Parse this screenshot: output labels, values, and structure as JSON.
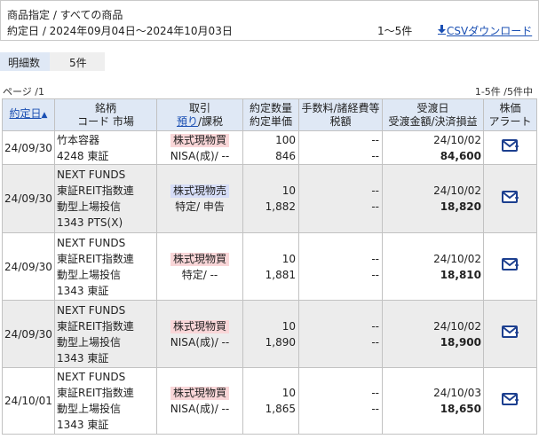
{
  "header": {
    "product_line": "商品指定 / すべての商品",
    "date_line": "約定日 / 2024年09月04日〜2024年10月03日",
    "count": "1〜5件",
    "csv_label": "CSVダウンロード"
  },
  "summary": {
    "label": "明細数",
    "value": "5件"
  },
  "pagination": {
    "page": "ページ /1",
    "range": "1-5件 /5件中"
  },
  "columns": {
    "date": "約定日",
    "name_1": "銘柄",
    "name_2": "コード 市場",
    "kind_1": "取引",
    "kind_2_a": "預り",
    "kind_2_b": "/課税",
    "qty_1": "約定数量",
    "qty_2": "約定単価",
    "fee_1": "手数料/諸経費等",
    "fee_2": "税額",
    "settle_1": "受渡日",
    "settle_2": "受渡金額/決済損益",
    "alert_1": "株価",
    "alert_2": "アラート"
  },
  "rows": [
    {
      "date": "24/09/30",
      "name1": "竹本容器",
      "name2": "4248 東証",
      "name3": "",
      "name4": "",
      "trade": "株式現物買",
      "trade_type": "buy",
      "account": "NISA(成)/ --",
      "qty": "100",
      "price": "846",
      "fee": "--",
      "tax": "--",
      "settle_date": "24/10/02",
      "amount": "84,600"
    },
    {
      "date": "24/09/30",
      "name1": "NEXT FUNDS",
      "name2": "東証REIT指数連",
      "name3": "動型上場投信",
      "name4": "1343 PTS(X)",
      "trade": "株式現物売",
      "trade_type": "sell",
      "account": "特定/ 申告",
      "qty": "10",
      "price": "1,882",
      "fee": "--",
      "tax": "--",
      "settle_date": "24/10/02",
      "amount": "18,820"
    },
    {
      "date": "24/09/30",
      "name1": "NEXT FUNDS",
      "name2": "東証REIT指数連",
      "name3": "動型上場投信",
      "name4": "1343 東証",
      "trade": "株式現物買",
      "trade_type": "buy",
      "account": "特定/ --",
      "qty": "10",
      "price": "1,881",
      "fee": "--",
      "tax": "--",
      "settle_date": "24/10/02",
      "amount": "18,810"
    },
    {
      "date": "24/09/30",
      "name1": "NEXT FUNDS",
      "name2": "東証REIT指数連",
      "name3": "動型上場投信",
      "name4": "1343 東証",
      "trade": "株式現物買",
      "trade_type": "buy",
      "account": "NISA(成)/ --",
      "qty": "10",
      "price": "1,890",
      "fee": "--",
      "tax": "--",
      "settle_date": "24/10/02",
      "amount": "18,900"
    },
    {
      "date": "24/10/01",
      "name1": "NEXT FUNDS",
      "name2": "東証REIT指数連",
      "name3": "動型上場投信",
      "name4": "1343 東証",
      "trade": "株式現物買",
      "trade_type": "buy",
      "account": "NISA(成)/ --",
      "qty": "10",
      "price": "1,865",
      "fee": "--",
      "tax": "--",
      "settle_date": "24/10/03",
      "amount": "18,650"
    }
  ],
  "colors": {
    "header_bg": "#dfe8f5",
    "link": "#1a4fb3",
    "buy_tag": "#f9d6d8",
    "sell_tag": "#d6ddf7",
    "alt_row": "#ececec",
    "icon": "#1c3f8f"
  }
}
